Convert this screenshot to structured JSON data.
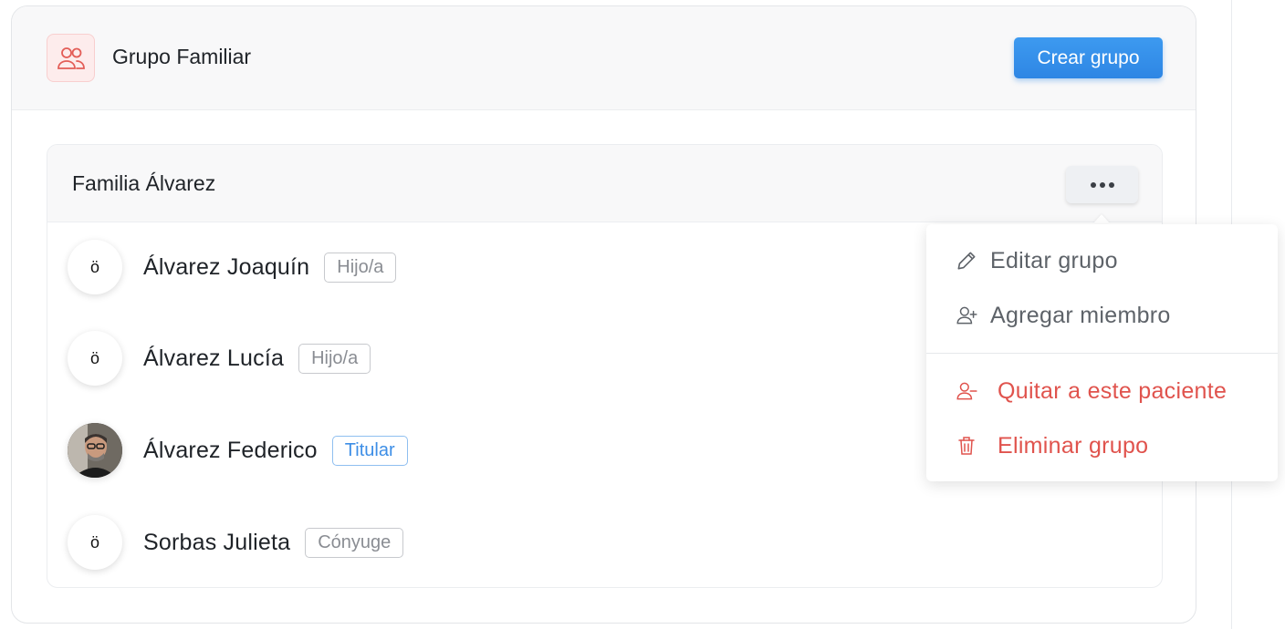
{
  "header": {
    "title": "Grupo Familiar",
    "icon": "users-icon",
    "create_button_label": "Crear grupo"
  },
  "family": {
    "title": "Familia Álvarez",
    "members": [
      {
        "initial": "ö",
        "name": "Álvarez Joaquín",
        "role": "Hijo/a",
        "avatar": "initial"
      },
      {
        "initial": "ö",
        "name": "Álvarez Lucía",
        "role": "Hijo/a",
        "avatar": "initial"
      },
      {
        "initial": "",
        "name": "Álvarez Federico",
        "role": "Titular",
        "avatar": "photo"
      },
      {
        "initial": "ö",
        "name": "Sorbas Julieta",
        "role": "Cónyuge",
        "avatar": "initial"
      }
    ]
  },
  "menu": {
    "items": [
      {
        "label": "Editar grupo",
        "icon": "pencil-icon"
      },
      {
        "label": "Agregar miembro",
        "icon": "user-plus-icon"
      },
      {
        "label": "Quitar a este paciente",
        "icon": "user-minus-icon"
      },
      {
        "label": "Eliminar grupo",
        "icon": "trash-icon"
      }
    ]
  },
  "colors": {
    "accent": "#2e86e4",
    "danger": "#e0534d",
    "header_icon_bg": "#fdecec"
  }
}
